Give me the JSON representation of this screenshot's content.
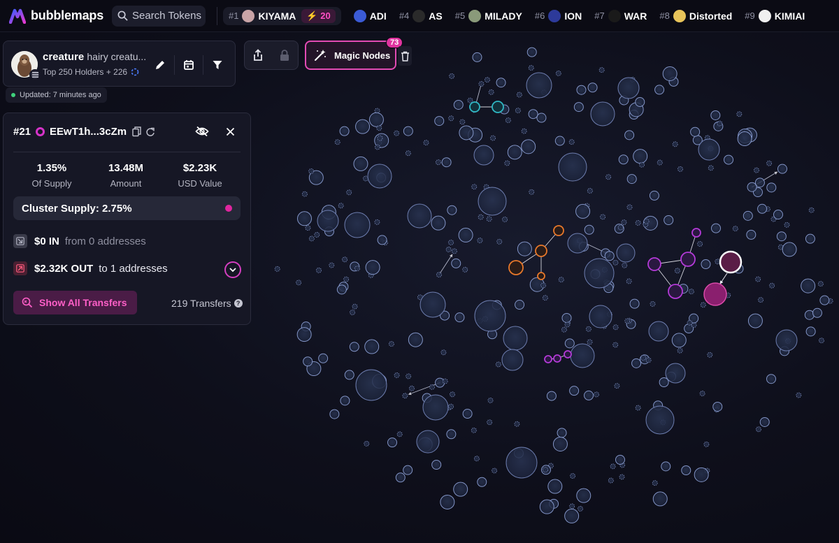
{
  "header": {
    "logo_text": "bubblemaps",
    "search_placeholder": "Search Tokens",
    "ticker": [
      {
        "rank": "#1",
        "name": "KIYAMA",
        "icon": "kiyama-avatar-icon",
        "badge": "20",
        "icon_color": "#c9a4a7"
      },
      {
        "rank": "",
        "name": "ADI",
        "icon": "adi-diamond-icon",
        "icon_color": "#3b5bd6"
      },
      {
        "rank": "#4",
        "name": "AS",
        "icon": "as-swirl-icon",
        "icon_color": "#2a2a2a"
      },
      {
        "rank": "#5",
        "name": "MILADY",
        "icon": "milady-avatar-icon",
        "icon_color": "#8a9a7a"
      },
      {
        "rank": "#6",
        "name": "ION",
        "icon": "ion-ghost-icon",
        "icon_color": "#2d3a9a"
      },
      {
        "rank": "#7",
        "name": "WAR",
        "icon": "war-logo-icon",
        "icon_color": "#1a1a1a"
      },
      {
        "rank": "#8",
        "name": "Distorted",
        "icon": "distorted-face-icon",
        "icon_color": "#e8c45a"
      },
      {
        "rank": "#9",
        "name": "KIMIAI",
        "icon": "kimiai-k-icon",
        "icon_color": "#f0f0f0"
      }
    ]
  },
  "token": {
    "name": "creature",
    "description": "hairy creatu...",
    "holders": "Top 250 Holders + 226",
    "updated": "Updated: 7 minutes ago"
  },
  "toolbar": {
    "magic_label": "Magic Nodes",
    "magic_count": "73"
  },
  "wallet": {
    "rank": "#21",
    "address": "EEwT1h...3cZm",
    "stats": [
      {
        "value": "1.35%",
        "label": "Of Supply"
      },
      {
        "value": "13.48M",
        "label": "Amount"
      },
      {
        "value": "$2.23K",
        "label": "USD Value"
      }
    ],
    "cluster_supply": "Cluster Supply: 2.75%",
    "in_value": "$0 IN",
    "in_detail": "from 0 addresses",
    "out_value": "$2.32K OUT",
    "out_detail": "to 1 addresses",
    "show_transfers_label": "Show All Transfers",
    "transfers_count": "219 Transfers",
    "help_mark": "?"
  },
  "colors": {
    "accent_pink": "#e0339f",
    "node_default": "#8fa3d9",
    "node_orange": "#e8782a",
    "node_teal": "#2fb8c4",
    "node_purple": "#b43ad8",
    "node_selected": "#5a1d46"
  }
}
